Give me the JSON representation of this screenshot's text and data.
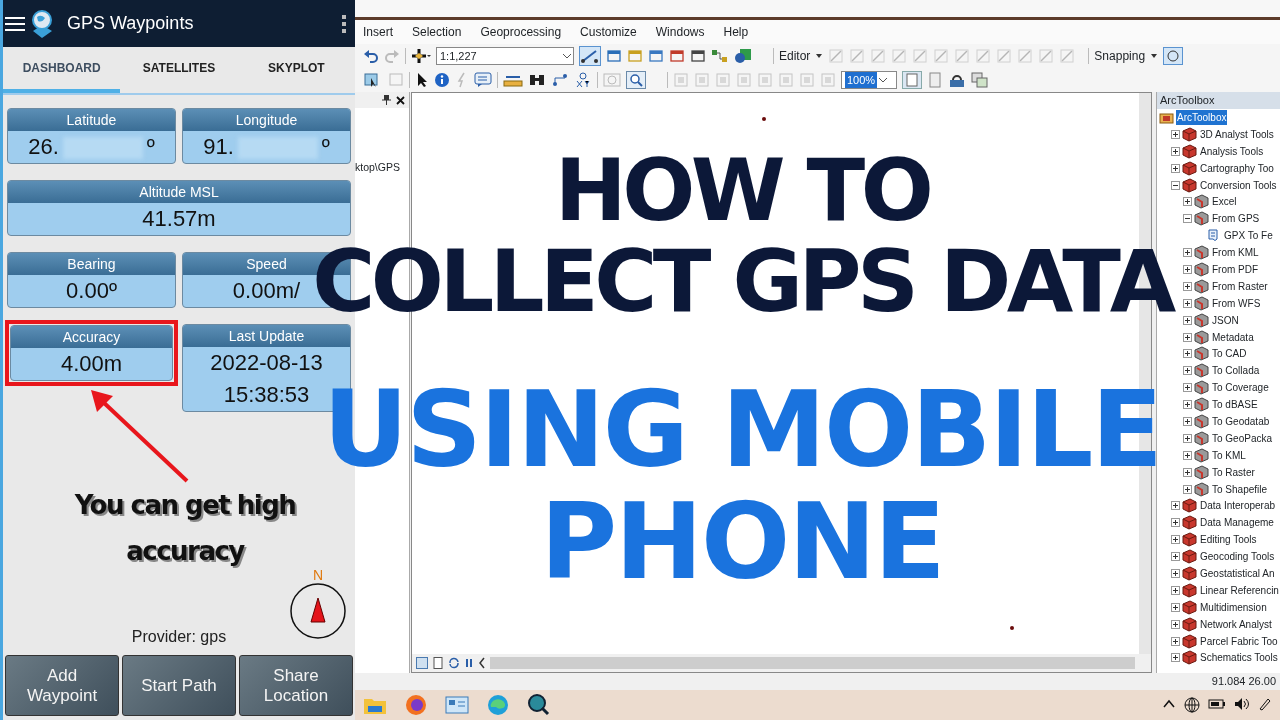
{
  "app": {
    "title": "GPS Waypoints"
  },
  "tabs": [
    {
      "label": "DASHBOARD",
      "selected": true
    },
    {
      "label": "SATELLITES",
      "selected": false
    },
    {
      "label": "SKYPLOT",
      "selected": false
    }
  ],
  "cards": [
    {
      "label": "Latitude",
      "value": "26.",
      "value_end": "º",
      "kind": "half",
      "obscured": true,
      "highlighted": false
    },
    {
      "label": "Longitude",
      "value": "91.",
      "value_end": "º",
      "kind": "half",
      "obscured": true,
      "highlighted": false
    },
    {
      "label": "Altitude MSL",
      "value": "41.57m",
      "kind": "full",
      "obscured": false,
      "highlighted": false
    },
    {
      "label": "Bearing",
      "value": "0.00º",
      "kind": "half",
      "obscured": false,
      "highlighted": false
    },
    {
      "label": "Speed",
      "value": "0.00m/",
      "kind": "half",
      "obscured": false,
      "highlighted": false
    },
    {
      "label": "Accuracy",
      "value": "4.00m",
      "kind": "half",
      "obscured": false,
      "highlighted": true
    },
    {
      "label": "Last Update",
      "value": "2022-08-13 15:38:53",
      "kind": "half",
      "obscured": false,
      "highlighted": false
    }
  ],
  "annotation": {
    "text": "You can get high accuracy"
  },
  "compass": {
    "label": "N"
  },
  "provider": "Provider: gps",
  "buttons": [
    "Add Waypoint",
    "Start Path",
    "Share Location"
  ],
  "desktop": {
    "menu": [
      "Insert",
      "Selection",
      "Geoprocessing",
      "Customize",
      "Windows",
      "Help"
    ],
    "scale": "1:1,227",
    "editor": "Editor",
    "snapping": "Snapping",
    "zoom_percent": "100%",
    "dock_path": "ktop\\GPS",
    "toolbox": {
      "title": "ArcToolbox",
      "tree": [
        {
          "label": "ArcToolbox",
          "kind": "root",
          "selected": true,
          "children": [
            {
              "label": "3D Analyst Tools",
              "kind": "toolbox",
              "expanded": false,
              "selected": false
            },
            {
              "label": "Analysis Tools",
              "kind": "toolbox",
              "expanded": false,
              "selected": false
            },
            {
              "label": "Cartography Too",
              "kind": "toolbox",
              "expanded": false,
              "selected": false
            },
            {
              "label": "Conversion Tools",
              "kind": "toolbox",
              "expanded": true,
              "selected": false,
              "children": [
                {
                  "label": "Excel",
                  "kind": "toolset",
                  "expanded": false,
                  "selected": false
                },
                {
                  "label": "From GPS",
                  "kind": "toolset",
                  "expanded": true,
                  "selected": false,
                  "children": [
                    {
                      "label": "GPX To Fe",
                      "kind": "tool",
                      "selected": false
                    }
                  ]
                },
                {
                  "label": "From KML",
                  "kind": "toolset",
                  "expanded": false,
                  "selected": false
                },
                {
                  "label": "From PDF",
                  "kind": "toolset",
                  "expanded": false,
                  "selected": false
                },
                {
                  "label": "From Raster",
                  "kind": "toolset",
                  "expanded": false,
                  "selected": false
                },
                {
                  "label": "From WFS",
                  "kind": "toolset",
                  "expanded": false,
                  "selected": false
                },
                {
                  "label": "JSON",
                  "kind": "toolset",
                  "expanded": false,
                  "selected": false
                },
                {
                  "label": "Metadata",
                  "kind": "toolset",
                  "expanded": false,
                  "selected": false
                },
                {
                  "label": "To CAD",
                  "kind": "toolset",
                  "expanded": false,
                  "selected": false
                },
                {
                  "label": "To Collada",
                  "kind": "toolset",
                  "expanded": false,
                  "selected": false
                },
                {
                  "label": "To Coverage",
                  "kind": "toolset",
                  "expanded": false,
                  "selected": false
                },
                {
                  "label": "To dBASE",
                  "kind": "toolset",
                  "expanded": false,
                  "selected": false
                },
                {
                  "label": "To Geodatab",
                  "kind": "toolset",
                  "expanded": false,
                  "selected": false
                },
                {
                  "label": "To GeoPacka",
                  "kind": "toolset",
                  "expanded": false,
                  "selected": false
                },
                {
                  "label": "To KML",
                  "kind": "toolset",
                  "expanded": false,
                  "selected": false
                },
                {
                  "label": "To Raster",
                  "kind": "toolset",
                  "expanded": false,
                  "selected": false
                },
                {
                  "label": "To Shapefile",
                  "kind": "toolset",
                  "expanded": false,
                  "selected": false
                }
              ]
            },
            {
              "label": "Data Interoperab",
              "kind": "toolbox",
              "expanded": false,
              "selected": false
            },
            {
              "label": "Data Manageme",
              "kind": "toolbox",
              "expanded": false,
              "selected": false
            },
            {
              "label": "Editing Tools",
              "kind": "toolbox",
              "expanded": false,
              "selected": false
            },
            {
              "label": "Geocoding Tools",
              "kind": "toolbox",
              "expanded": false,
              "selected": false
            },
            {
              "label": "Geostatistical An",
              "kind": "toolbox",
              "expanded": false,
              "selected": false
            },
            {
              "label": "Linear Referencin",
              "kind": "toolbox",
              "expanded": false,
              "selected": false
            },
            {
              "label": "Multidimension",
              "kind": "toolbox",
              "expanded": false,
              "selected": false
            },
            {
              "label": "Network Analyst",
              "kind": "toolbox",
              "expanded": false,
              "selected": false
            },
            {
              "label": "Parcel Fabric Too",
              "kind": "toolbox",
              "expanded": false,
              "selected": false
            },
            {
              "label": "Schematics Tools",
              "kind": "toolbox",
              "expanded": false,
              "selected": false
            }
          ]
        }
      ]
    },
    "status": "91.084  26.00"
  },
  "headline": [
    {
      "text": "HOW TO",
      "kind": "dark"
    },
    {
      "text": "COLLECT GPS DATA",
      "kind": "dark"
    },
    {
      "text": "USING MOBILE",
      "kind": "blue"
    },
    {
      "text": "PHONE",
      "kind": "blue"
    }
  ]
}
